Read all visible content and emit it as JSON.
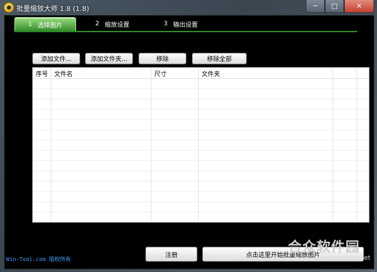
{
  "window": {
    "title": "批量缩放大师 1.8 (1.8)"
  },
  "titlebar_buttons": {
    "min": "─",
    "max": "□",
    "close": "✕"
  },
  "tabs": [
    {
      "num": "1",
      "label": "选择图片"
    },
    {
      "num": "2",
      "label": "缩放设置"
    },
    {
      "num": "3",
      "label": "输出设置"
    }
  ],
  "toolbar": {
    "add_file": "添加文件...",
    "add_folder": "添加文件夹...",
    "remove": "移除",
    "remove_all": "移除全部"
  },
  "table": {
    "columns": [
      "序号",
      "文件名",
      "尺寸",
      "文件夹"
    ],
    "rows": []
  },
  "footer": {
    "copyright": "Win-Tool.com 版权所有",
    "register": "注册",
    "start": "点击这里开始批量缩放图片"
  },
  "watermark": {
    "brand": "合众软件园",
    "url": "www.hezhong.net"
  },
  "colors": {
    "active_tab": "#2f8a26",
    "footer_link": "#3ba0ff",
    "content_bg": "#000000"
  }
}
